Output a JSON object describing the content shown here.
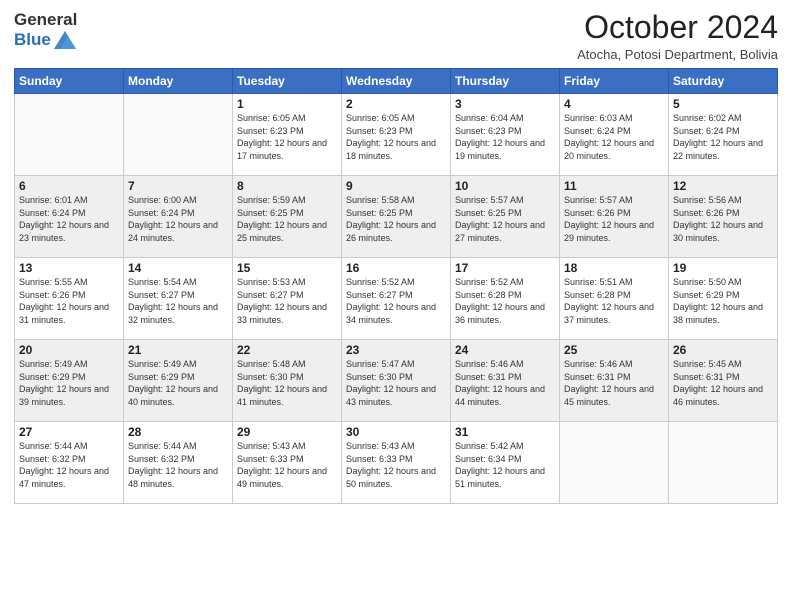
{
  "logo": {
    "general": "General",
    "blue": "Blue"
  },
  "header": {
    "month": "October 2024",
    "location": "Atocha, Potosi Department, Bolivia"
  },
  "weekdays": [
    "Sunday",
    "Monday",
    "Tuesday",
    "Wednesday",
    "Thursday",
    "Friday",
    "Saturday"
  ],
  "weeks": [
    [
      {
        "day": "",
        "info": ""
      },
      {
        "day": "",
        "info": ""
      },
      {
        "day": "1",
        "info": "Sunrise: 6:05 AM\nSunset: 6:23 PM\nDaylight: 12 hours and 17 minutes."
      },
      {
        "day": "2",
        "info": "Sunrise: 6:05 AM\nSunset: 6:23 PM\nDaylight: 12 hours and 18 minutes."
      },
      {
        "day": "3",
        "info": "Sunrise: 6:04 AM\nSunset: 6:23 PM\nDaylight: 12 hours and 19 minutes."
      },
      {
        "day": "4",
        "info": "Sunrise: 6:03 AM\nSunset: 6:24 PM\nDaylight: 12 hours and 20 minutes."
      },
      {
        "day": "5",
        "info": "Sunrise: 6:02 AM\nSunset: 6:24 PM\nDaylight: 12 hours and 22 minutes."
      }
    ],
    [
      {
        "day": "6",
        "info": "Sunrise: 6:01 AM\nSunset: 6:24 PM\nDaylight: 12 hours and 23 minutes."
      },
      {
        "day": "7",
        "info": "Sunrise: 6:00 AM\nSunset: 6:24 PM\nDaylight: 12 hours and 24 minutes."
      },
      {
        "day": "8",
        "info": "Sunrise: 5:59 AM\nSunset: 6:25 PM\nDaylight: 12 hours and 25 minutes."
      },
      {
        "day": "9",
        "info": "Sunrise: 5:58 AM\nSunset: 6:25 PM\nDaylight: 12 hours and 26 minutes."
      },
      {
        "day": "10",
        "info": "Sunrise: 5:57 AM\nSunset: 6:25 PM\nDaylight: 12 hours and 27 minutes."
      },
      {
        "day": "11",
        "info": "Sunrise: 5:57 AM\nSunset: 6:26 PM\nDaylight: 12 hours and 29 minutes."
      },
      {
        "day": "12",
        "info": "Sunrise: 5:56 AM\nSunset: 6:26 PM\nDaylight: 12 hours and 30 minutes."
      }
    ],
    [
      {
        "day": "13",
        "info": "Sunrise: 5:55 AM\nSunset: 6:26 PM\nDaylight: 12 hours and 31 minutes."
      },
      {
        "day": "14",
        "info": "Sunrise: 5:54 AM\nSunset: 6:27 PM\nDaylight: 12 hours and 32 minutes."
      },
      {
        "day": "15",
        "info": "Sunrise: 5:53 AM\nSunset: 6:27 PM\nDaylight: 12 hours and 33 minutes."
      },
      {
        "day": "16",
        "info": "Sunrise: 5:52 AM\nSunset: 6:27 PM\nDaylight: 12 hours and 34 minutes."
      },
      {
        "day": "17",
        "info": "Sunrise: 5:52 AM\nSunset: 6:28 PM\nDaylight: 12 hours and 36 minutes."
      },
      {
        "day": "18",
        "info": "Sunrise: 5:51 AM\nSunset: 6:28 PM\nDaylight: 12 hours and 37 minutes."
      },
      {
        "day": "19",
        "info": "Sunrise: 5:50 AM\nSunset: 6:29 PM\nDaylight: 12 hours and 38 minutes."
      }
    ],
    [
      {
        "day": "20",
        "info": "Sunrise: 5:49 AM\nSunset: 6:29 PM\nDaylight: 12 hours and 39 minutes."
      },
      {
        "day": "21",
        "info": "Sunrise: 5:49 AM\nSunset: 6:29 PM\nDaylight: 12 hours and 40 minutes."
      },
      {
        "day": "22",
        "info": "Sunrise: 5:48 AM\nSunset: 6:30 PM\nDaylight: 12 hours and 41 minutes."
      },
      {
        "day": "23",
        "info": "Sunrise: 5:47 AM\nSunset: 6:30 PM\nDaylight: 12 hours and 43 minutes."
      },
      {
        "day": "24",
        "info": "Sunrise: 5:46 AM\nSunset: 6:31 PM\nDaylight: 12 hours and 44 minutes."
      },
      {
        "day": "25",
        "info": "Sunrise: 5:46 AM\nSunset: 6:31 PM\nDaylight: 12 hours and 45 minutes."
      },
      {
        "day": "26",
        "info": "Sunrise: 5:45 AM\nSunset: 6:31 PM\nDaylight: 12 hours and 46 minutes."
      }
    ],
    [
      {
        "day": "27",
        "info": "Sunrise: 5:44 AM\nSunset: 6:32 PM\nDaylight: 12 hours and 47 minutes."
      },
      {
        "day": "28",
        "info": "Sunrise: 5:44 AM\nSunset: 6:32 PM\nDaylight: 12 hours and 48 minutes."
      },
      {
        "day": "29",
        "info": "Sunrise: 5:43 AM\nSunset: 6:33 PM\nDaylight: 12 hours and 49 minutes."
      },
      {
        "day": "30",
        "info": "Sunrise: 5:43 AM\nSunset: 6:33 PM\nDaylight: 12 hours and 50 minutes."
      },
      {
        "day": "31",
        "info": "Sunrise: 5:42 AM\nSunset: 6:34 PM\nDaylight: 12 hours and 51 minutes."
      },
      {
        "day": "",
        "info": ""
      },
      {
        "day": "",
        "info": ""
      }
    ]
  ]
}
